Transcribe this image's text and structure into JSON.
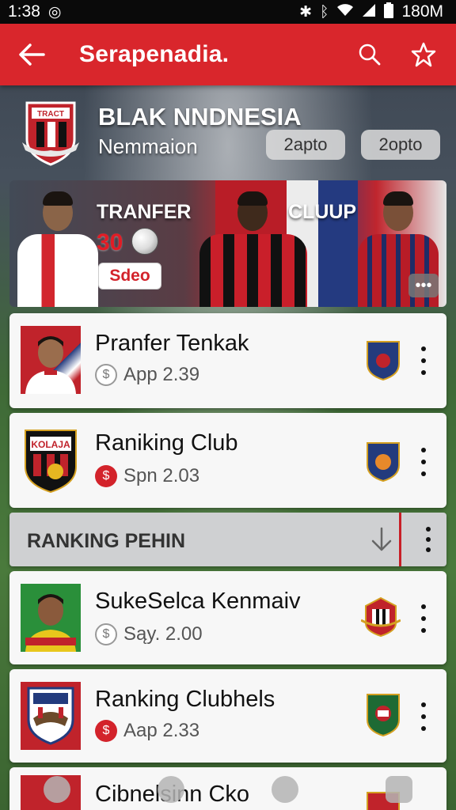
{
  "status_bar": {
    "time": "1:38",
    "right_text": "180M",
    "icons": [
      "notification-icon",
      "bluetooth-icon",
      "vibrate-icon",
      "wifi-icon",
      "signal-icon",
      "battery-icon"
    ]
  },
  "app_bar": {
    "title": "Serapenadia.",
    "icons": [
      "back-arrow-icon",
      "search-icon",
      "star-icon"
    ]
  },
  "club_header": {
    "name": "BLAK NNDNESIA",
    "subtitle": "Nemmaion",
    "crest_text": "TRACT",
    "pills": [
      "2apto",
      "2opto"
    ]
  },
  "banner": {
    "left_heading": "TRANFER",
    "right_heading": "CLUUP",
    "number": "30",
    "button_label": "Sdeo",
    "more_label": "•••"
  },
  "cards": [
    {
      "title": "Pranfer Tenkak",
      "meta": "App 2.39",
      "meta_icon": "grey"
    },
    {
      "title": "Raniking Club",
      "meta": "Spn 2.03",
      "meta_icon": "red",
      "crest_text": "KOLAJA"
    }
  ],
  "section": {
    "label": "RANKING PEHIN"
  },
  "cards2": [
    {
      "title": "SukeSelca Kenmaiv",
      "meta": "Sąy. 2.00",
      "meta_icon": "grey"
    },
    {
      "title": "Ranking Clubhels",
      "meta": "Aap 2.33",
      "meta_icon": "red"
    }
  ],
  "partial_card": {
    "title": "Cibnelsinn Cko"
  },
  "colors": {
    "accent": "#d9262c",
    "card_bg": "#f7f7f7",
    "section_bg": "#cfd0d2"
  }
}
